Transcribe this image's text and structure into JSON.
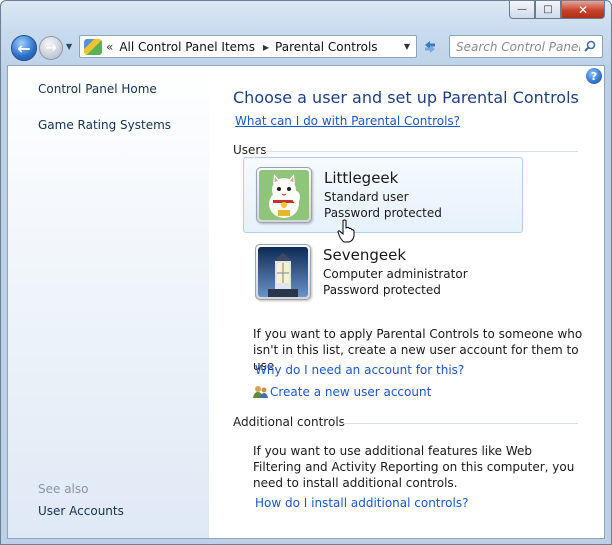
{
  "window": {
    "minimize_label": "—",
    "maximize_label": "□",
    "close_label": "✕"
  },
  "nav": {
    "breadcrumb_prefix": "«",
    "breadcrumb": [
      "All Control Panel Items",
      "Parental Controls"
    ],
    "breadcrumb_separator": "▸",
    "search_placeholder": "Search Control Panel"
  },
  "sidebar": {
    "links": [
      "Control Panel Home",
      "Game Rating Systems"
    ],
    "see_also_label": "See also",
    "see_also_links": [
      "User Accounts"
    ]
  },
  "main": {
    "title": "Choose a user and set up Parental Controls",
    "help_link": "What can I do with Parental Controls?",
    "users_header": "Users",
    "users": [
      {
        "name": "Littlegeek",
        "role": "Standard user",
        "status": "Password protected",
        "avatar_icon": "lucky-cat-icon"
      },
      {
        "name": "Sevengeek",
        "role": "Computer administrator",
        "status": "Password protected",
        "avatar_icon": "lighthouse-icon"
      }
    ],
    "add_user_text": "If you want to apply Parental Controls to someone who isn't in this list, create a new user account for them to use.",
    "why_account_link": "Why do I need an account for this?",
    "create_account_link": "Create a new user account",
    "additional_header": "Additional controls",
    "additional_text": "If you want to use additional features like Web Filtering and Activity Reporting on this computer, you need to install additional controls.",
    "install_link": "How do I install additional controls?"
  },
  "colors": {
    "title_blue": "#1f3f82",
    "link_blue": "#1b57c7",
    "hover_card": "#e6f1fc"
  }
}
